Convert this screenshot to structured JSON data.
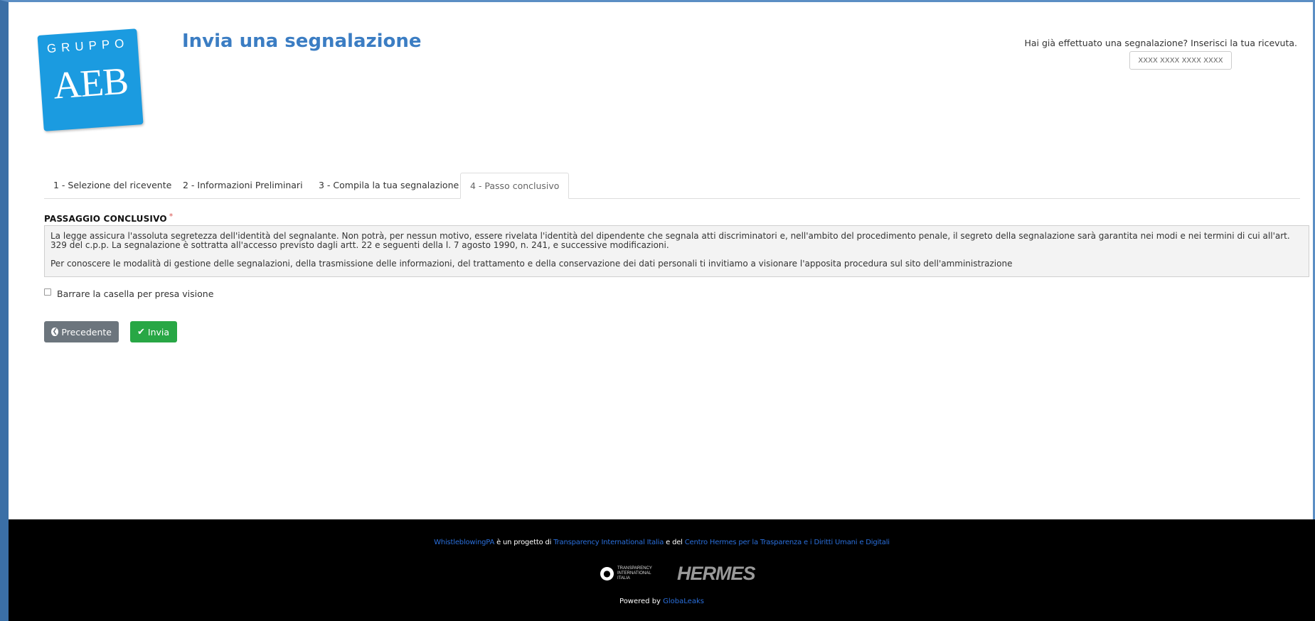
{
  "header": {
    "logo_top": "GRUPPO",
    "logo_main": "AEB",
    "title": "Invia una segnalazione",
    "receipt_prompt": "Hai già effettuato una segnalazione? Inserisci la tua ricevuta.",
    "receipt_placeholder": "XXXX XXXX XXXX XXXX"
  },
  "tabs": [
    {
      "label": "1 - Selezione del ricevente",
      "active": false
    },
    {
      "label": "2 - Informazioni Preliminari",
      "active": false
    },
    {
      "label": "3 - Compila la tua segnalazione",
      "active": false
    },
    {
      "label": "4 - Passo conclusivo",
      "active": true
    }
  ],
  "section": {
    "title": "PASSAGGIO CONCLUSIVO",
    "required_mark": "*",
    "paragraph1": "La legge assicura l'assoluta segretezza dell'identità del segnalante. Non potrà, per nessun motivo, essere rivelata l'identità del dipendente che segnala atti discriminatori e, nell'ambito del procedimento penale, il segreto della segnalazione sarà garantita nei modi e nei termini di cui all'art. 329 del c.p.p. La segnalazione è sottratta all'accesso previsto dagli artt. 22 e seguenti della l. 7 agosto 1990, n. 241, e successive modificazioni.",
    "paragraph2": "Per conoscere le modalità di gestione delle segnalazioni, della trasmissione delle informazioni, del trattamento e della conservazione dei dati personali ti invitiamo a visionare l'apposita procedura sul sito dell'amministrazione",
    "checkbox_label": "Barrare la casella per presa visione",
    "checkbox_checked": false
  },
  "buttons": {
    "previous": "Precedente",
    "send": "Invia"
  },
  "footer": {
    "project_link": "WhistleblowingPA",
    "text1": " è un progetto di ",
    "ti_link": "Transparency International Italia",
    "text2": " e del ",
    "hermes_link": "Centro Hermes per la Trasparenza e i Diritti Umani e Digitali",
    "ti_logo_text": "TRANSPARENCY INTERNATIONAL ITALIA",
    "hermes_logo_text": "HERMES",
    "powered_by": "Powered by ",
    "globaleaks_link": "GlobaLeaks"
  },
  "colors": {
    "title_blue": "#3b7dc3",
    "logo_blue": "#1b9be0",
    "prev_button": "#6c757d",
    "send_button": "#28a745",
    "footer_bg": "#000000",
    "link": "#2a6fdb"
  }
}
